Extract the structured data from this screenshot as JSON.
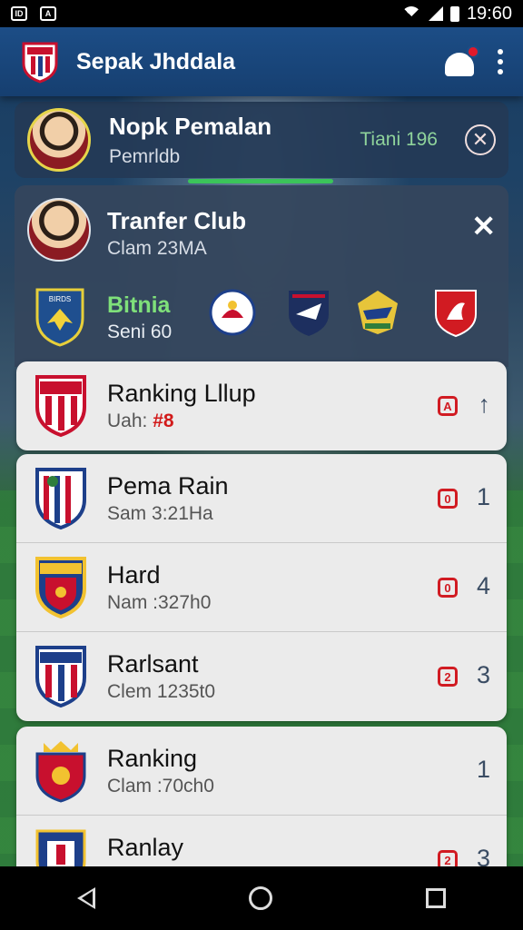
{
  "status_bar": {
    "time": "19:60"
  },
  "app_bar": {
    "title": "Sepak Jhddala"
  },
  "top_card": {
    "name": "Nopk Pemalan",
    "subtitle": "Pemrldb",
    "meta": "Tiani 196"
  },
  "transfer": {
    "title": "Tranfer Club",
    "subtitle": "Clam 23MA",
    "club_name": "Bitnia",
    "club_sub": "Seni 60"
  },
  "rankings": [
    {
      "name": "Ranking Lllup",
      "sub_prefix": "Uah: ",
      "sub_value": "#8",
      "badge": "A",
      "value": "↑",
      "colors": [
        "#c8102e",
        "#ffffff"
      ]
    },
    {
      "name": "Pema Rain",
      "sub": "Sam 3:21Ha",
      "badge": "0",
      "value": "1",
      "colors": [
        "#c8102e",
        "#1d3f8a"
      ]
    },
    {
      "name": "Hard",
      "sub": "Nam :327h0",
      "badge": "0",
      "value": "4",
      "colors": [
        "#f2c230",
        "#1d3f8a"
      ]
    },
    {
      "name": "Rarlsant",
      "sub": "Clem 1235t0",
      "badge": "2",
      "value": "3",
      "colors": [
        "#1d3f8a",
        "#c8102e"
      ]
    },
    {
      "name": "Ranking",
      "sub": "Clam :70ch0",
      "badge": "",
      "value": "1",
      "colors": [
        "#c8102e",
        "#f2c230"
      ]
    },
    {
      "name": "Ranlay",
      "sub": "",
      "badge": "2",
      "value": "3",
      "colors": [
        "#1d3f8a",
        "#c8102e"
      ]
    }
  ],
  "colors": {
    "accent_green": "#3bc45a",
    "alert_red": "#d11b22",
    "appbar_blue": "#1c4d86"
  }
}
